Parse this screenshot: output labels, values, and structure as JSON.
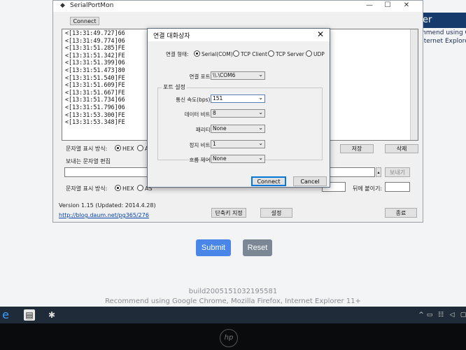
{
  "browser_page": {
    "submit_label": "Submit",
    "reset_label": "Reset",
    "build_text": "build2005151032195581",
    "recommend_text": "Recommend using Google Chrome, Mozilla Firefox, Internet Explorer 11+",
    "right_title_fragment": "er",
    "right_line1": "mmend using Goo",
    "right_line2": "nternet Explore"
  },
  "app": {
    "title": "SerialPortMon",
    "connect_label": "Connect",
    "log_lines": [
      "<[13:31:49.727]66",
      "<[13:31:49.774]06",
      "<[13:31:51.285]FE",
      "<[13:31:51.342]FE",
      "<[13:31:51.399]06",
      "<[13:31:51.473]80",
      "<[13:31:51.540]FE",
      "<[13:31:51.609]FE",
      "<[13:31:51.667]FE",
      "<[13:31:51.734]66",
      "<[13:31:51.796]06",
      "<[13:31:53.300]FE",
      "<[13:31:53.348]FE"
    ],
    "display_mode_label": "문자열 표시 방식:",
    "hex_label": "HEX",
    "as_label": "AS",
    "save_label": "저장",
    "delete_label": "삭제",
    "send_edit_label": "보내는 문자열 편집",
    "send_label": "보내기",
    "display_mode_label2": "문자열 표시 방식:",
    "hex_label2": "HEX",
    "as_label2": "AS",
    "append_label": "뒤에 붙이기:",
    "version_text": "Version 1.15 (Updated: 2014.4.28)",
    "link_text": "http://blog.daum.net/pg365/276",
    "shortcut_label": "단축키 지정",
    "settings_label": "설정",
    "exit_label": "종료"
  },
  "dialog": {
    "title": "연결 대화상자",
    "conn_state_label": "연결 형태:",
    "conn_types": [
      "Serial(COM)",
      "TCP Client",
      "TCP Server",
      "UDP"
    ],
    "conn_port_label": "연결 포트:",
    "conn_port_value": "\\\\.\\COM6",
    "port_settings_label": "포트 설정",
    "baud_label": "통신 속도(bps):",
    "baud_value": "151",
    "databits_label": "데이터 비트:",
    "databits_value": "8",
    "parity_label": "패리티:",
    "parity_value": "None",
    "stopbits_label": "정지 비트:",
    "stopbits_value": "1",
    "flow_label": "흐름 제어:",
    "flow_value": "None",
    "connect_label": "Connect",
    "cancel_label": "Cancel"
  },
  "logo_text": "hp",
  "colors": {
    "submit_bg": "#4a86e8",
    "reset_bg": "#7b8794",
    "taskbar_bg": "#1f2b38"
  }
}
